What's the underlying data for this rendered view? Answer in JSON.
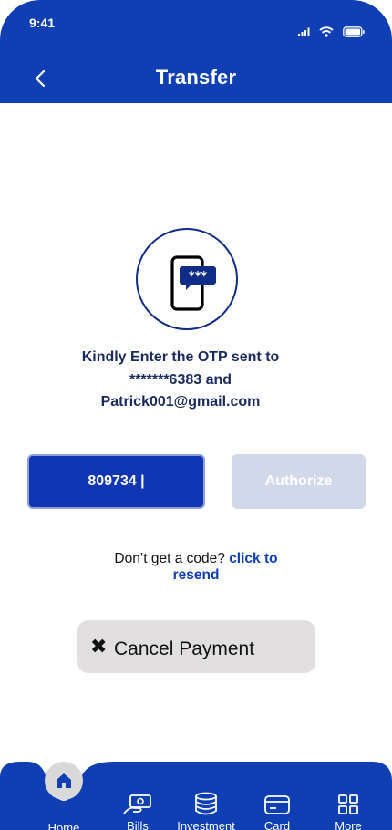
{
  "status_bar": {
    "time": "9:41"
  },
  "header": {
    "title": "Transfer"
  },
  "otp": {
    "message": "Kindly Enter the OTP sent to *******6383 and Patrick001@gmail.com",
    "input_value": "809734 |",
    "bubble_text": "***"
  },
  "actions": {
    "authorize_label": "Authorize",
    "cancel_label": "Cancel Payment"
  },
  "resend": {
    "prompt": "Don’t get  a code? ",
    "link": "click to resend"
  },
  "tabs": [
    {
      "label": "Home",
      "icon": "home-icon"
    },
    {
      "label": "Bills",
      "icon": "bills-icon"
    },
    {
      "label": "Investment",
      "icon": "investment-icon"
    },
    {
      "label": "Card",
      "icon": "card-icon"
    },
    {
      "label": "More",
      "icon": "more-icon"
    }
  ],
  "colors": {
    "primary": "#0f3fb3",
    "disabled": "#d1d8ea",
    "cancel_bg": "#e1dfdf",
    "text_dark": "#1b2a5c"
  }
}
